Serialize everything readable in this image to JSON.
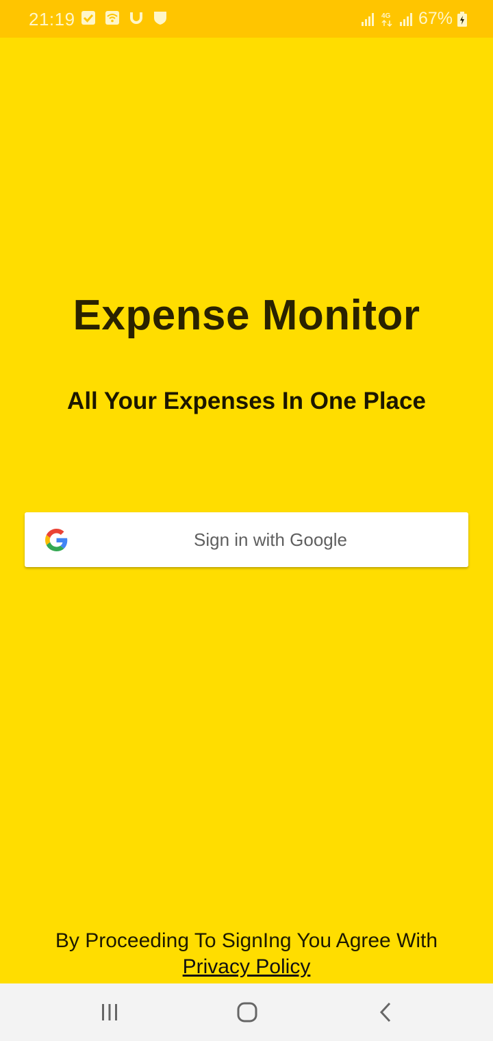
{
  "status_bar": {
    "time": "21:19",
    "battery_percent": "67%",
    "icons_left": [
      "checkbox-icon",
      "wifi-hotspot-icon",
      "magnet-icon",
      "shield-icon"
    ],
    "icons_right": [
      "signal-icon",
      "4g-icon",
      "signal-icon",
      "battery-icon"
    ]
  },
  "main": {
    "title": "Expense Monitor",
    "subtitle": "All Your Expenses In One Place",
    "google_button_label": "Sign in with Google"
  },
  "footer": {
    "agreement_text": "By Proceeding To SignIng You Agree With",
    "privacy_link": "Privacy Policy"
  },
  "nav_bar": {
    "buttons": [
      "recent-apps-icon",
      "home-icon",
      "back-icon"
    ]
  },
  "colors": {
    "background": "#FFDD00",
    "status_bar": "#FFC500",
    "button": "#FFFFFF",
    "nav_bar": "#F3F3F3"
  }
}
